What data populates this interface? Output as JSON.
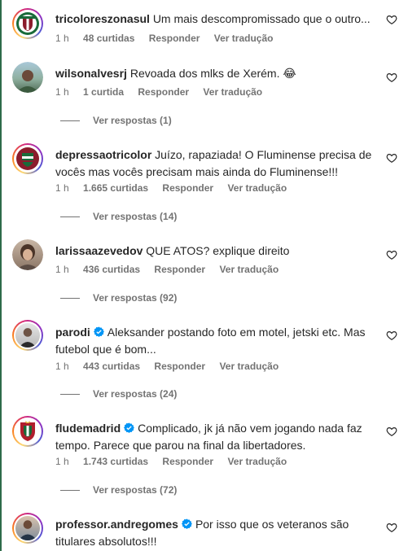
{
  "colors": {
    "text": "#262626",
    "muted": "#737373",
    "verified": "#0095f6",
    "story_ring": [
      "#feda75",
      "#fa7e1e",
      "#d62976",
      "#962fbf",
      "#4f5bd5"
    ]
  },
  "comments": [
    {
      "username": "tricoloreszonasul",
      "text": "Um mais descompromissado que o outro...",
      "time": "1 h",
      "likes": "48 curtidas",
      "reply_label": "Responder",
      "translate_label": "Ver tradução",
      "avatar": "club-crest",
      "verified": false
    },
    {
      "username": "wilsonalvesrj",
      "text": "Revoada dos mlks de Xerém. 😂",
      "time": "1 h",
      "likes": "1 curtida",
      "reply_label": "Responder",
      "translate_label": "Ver tradução",
      "avatar": "person-photo",
      "verified": false,
      "view_replies": "Ver respostas (1)"
    },
    {
      "username": "depressaotricolor",
      "text": "Juízo, rapaziada! O Fluminense precisa de vocês mas vocês precisam mais ainda do Fluminense!!!",
      "time": "1 h",
      "likes": "1.665 curtidas",
      "reply_label": "Responder",
      "translate_label": "Ver tradução",
      "avatar": "club-crest",
      "verified": false,
      "view_replies": "Ver respostas (14)"
    },
    {
      "username": "larissaazevedov",
      "text": "QUE ATOS? explique direito",
      "time": "1 h",
      "likes": "436 curtidas",
      "reply_label": "Responder",
      "translate_label": "Ver tradução",
      "avatar": "person-photo",
      "verified": false,
      "view_replies": "Ver respostas (92)"
    },
    {
      "username": "parodi",
      "text": "Aleksander postando foto em motel, jetski etc. Mas futebol que é bom...",
      "time": "1 h",
      "likes": "443 curtidas",
      "reply_label": "Responder",
      "translate_label": "Ver tradução",
      "avatar": "person-photo",
      "verified": true,
      "view_replies": "Ver respostas (24)"
    },
    {
      "username": "fludemadrid",
      "text": "Complicado, jk já não vem jogando nada faz tempo. Parece que parou na final da libertadores.",
      "time": "1 h",
      "likes": "1.743 curtidas",
      "reply_label": "Responder",
      "translate_label": "Ver tradução",
      "avatar": "club-crest",
      "verified": true,
      "view_replies": "Ver respostas (72)"
    },
    {
      "username": "professor.andregomes",
      "text": "Por isso que os veteranos são titulares absolutos!!!",
      "avatar": "person-photo",
      "verified": true
    }
  ]
}
